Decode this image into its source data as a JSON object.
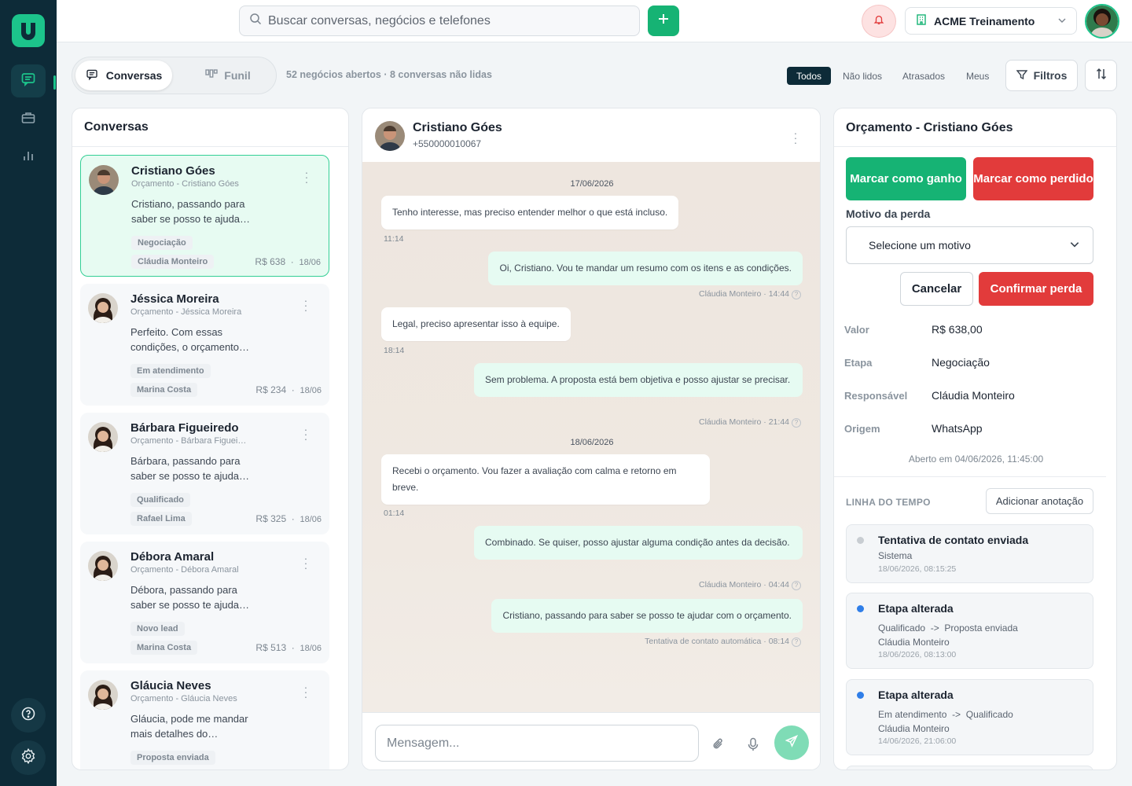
{
  "app": {
    "brand_color": "#1cc48b",
    "primary": "#16b374",
    "danger": "#e23b3b"
  },
  "nav": {
    "items": [
      "chat-icon",
      "briefcase-icon",
      "bar-chart-icon"
    ],
    "bottom": [
      "help-icon",
      "gear-icon"
    ]
  },
  "topbar": {
    "search_placeholder": "Buscar conversas, negócios e telefones",
    "company": "ACME Treinamento"
  },
  "subbar": {
    "tab_conversas": "Conversas",
    "tab_funil": "Funil",
    "summary": "52 negócios abertos · 8 conversas não lidas",
    "filters": [
      "Todos",
      "Não lidos",
      "Atrasados",
      "Meus"
    ],
    "filters_button": "Filtros"
  },
  "conversations": {
    "title": "Conversas",
    "items": [
      {
        "name": "Cristiano Góes",
        "sub": "Orçamento - Cristiano Góes",
        "preview": "Cristiano, passando para saber se posso te ajuda…",
        "tag": "Negociação",
        "owner": "Cláudia Monteiro",
        "amount": "R$ 638",
        "date": "18/06"
      },
      {
        "name": "Jéssica Moreira",
        "sub": "Orçamento - Jéssica Moreira",
        "preview": "Perfeito. Com essas condições, o orçamento…",
        "tag": "Em atendimento",
        "owner": "Marina Costa",
        "amount": "R$ 234",
        "date": "18/06"
      },
      {
        "name": "Bárbara Figueiredo",
        "sub": "Orçamento - Bárbara Figuei…",
        "preview": "Bárbara, passando para saber se posso te ajuda…",
        "tag": "Qualificado",
        "owner": "Rafael Lima",
        "amount": "R$ 325",
        "date": "18/06"
      },
      {
        "name": "Débora Amaral",
        "sub": "Orçamento - Débora Amaral",
        "preview": "Débora, passando para saber se posso te ajuda…",
        "tag": "Novo lead",
        "owner": "Marina Costa",
        "amount": "R$ 513",
        "date": "18/06"
      },
      {
        "name": "Gláucia Neves",
        "sub": "Orçamento - Gláucia Neves",
        "preview": "Gláucia, pode me mandar mais detalhes do…",
        "tag": "Proposta enviada",
        "owner": "",
        "amount": "",
        "date": ""
      }
    ]
  },
  "chat": {
    "name": "Cristiano Góes",
    "phone": "+550000010067",
    "input_placeholder": "Mensagem...",
    "date1": "17/06/2026",
    "date2": "18/06/2026",
    "messages": [
      {
        "text": "Tenho interesse, mas preciso entender melhor o que está incluso.",
        "time": "11:14"
      },
      {
        "text": "Oi, Cristiano. Vou te mandar um resumo com os itens e as condições.",
        "author": "Cláudia Monteiro",
        "time": "14:44"
      },
      {
        "text": "Legal, preciso apresentar isso à equipe.",
        "time": "18:14"
      },
      {
        "text": "Sem problema. A proposta está bem objetiva e posso ajustar se precisar.",
        "author": "Cláudia Monteiro",
        "time": "21:44"
      },
      {
        "text": "Recebi o orçamento. Vou fazer a avaliação com calma e retorno em breve.",
        "time": "01:14"
      },
      {
        "text": "Combinado. Se quiser, posso ajustar alguma condição antes da decisão.",
        "author": "Cláudia Monteiro",
        "time": "04:44"
      },
      {
        "text": "Cristiano, passando para saber se posso te ajudar com o orçamento.",
        "author": "Tentativa de contato automática",
        "time": "08:14"
      }
    ]
  },
  "deal": {
    "title": "Orçamento - Cristiano Góes",
    "won": "Marcar como ganho",
    "lost": "Marcar como perdido",
    "reason_label": "Motivo da perda",
    "reason_placeholder": "Selecione um motivo",
    "cancel": "Cancelar",
    "confirm": "Confirmar perda",
    "fields": [
      {
        "label": "Valor",
        "value": "R$ 638,00"
      },
      {
        "label": "Etapa",
        "value": "Negociação"
      },
      {
        "label": "Responsável",
        "value": "Cláudia Monteiro"
      },
      {
        "label": "Origem",
        "value": "WhatsApp"
      }
    ],
    "opened": "Aberto em 04/06/2026, 11:45:00",
    "timeline_label": "LINHA DO TEMPO",
    "add_note": "Adicionar anotação",
    "timeline": [
      {
        "title": "Tentativa de contato enviada",
        "line1": "Sistema",
        "date": "18/06/2026, 08:15:25"
      },
      {
        "title": "Etapa alterada",
        "from": "Qualificado",
        "to": "Proposta enviada",
        "arrow": "->",
        "line2": "Cláudia Monteiro",
        "date": "18/06/2026, 08:13:00"
      },
      {
        "title": "Etapa alterada",
        "from": "Em atendimento",
        "to": "Qualificado",
        "arrow": "->",
        "line2": "Cláudia Monteiro",
        "date": "14/06/2026, 21:06:00"
      }
    ]
  }
}
